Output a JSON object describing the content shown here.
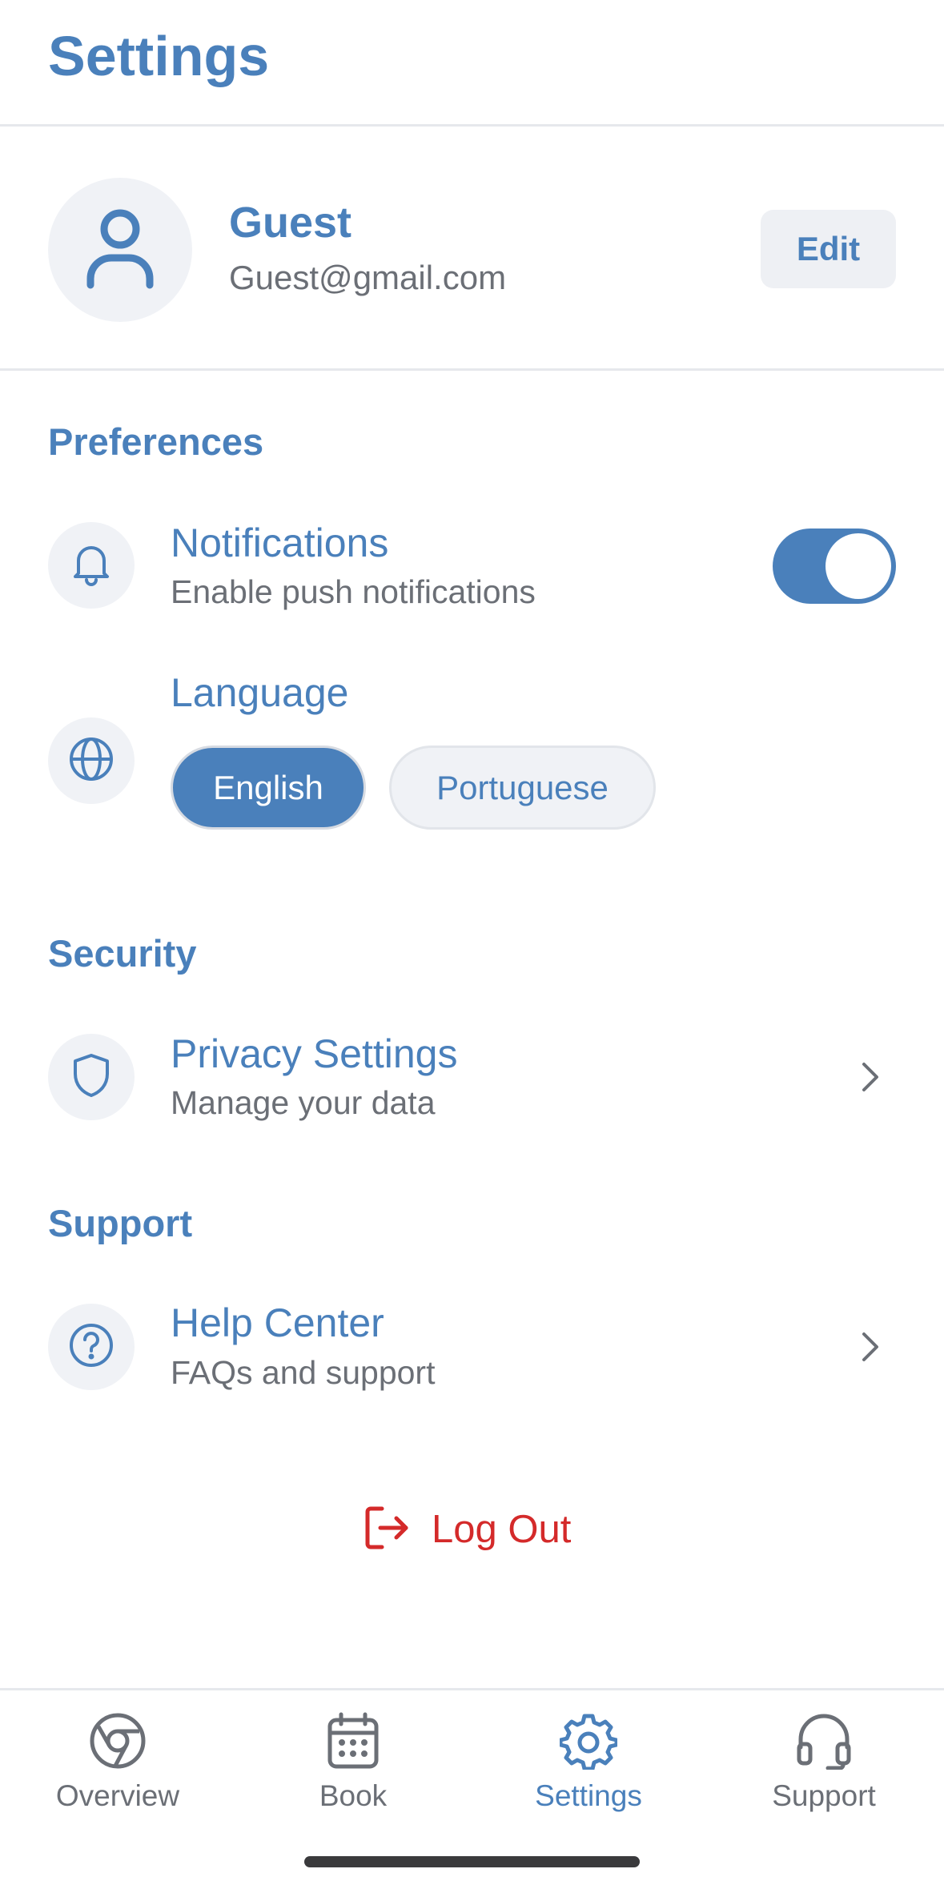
{
  "header": {
    "title": "Settings"
  },
  "profile": {
    "name": "Guest",
    "email": "Guest@gmail.com",
    "edit_label": "Edit",
    "avatar_icon": "user-icon"
  },
  "preferences": {
    "section_title": "Preferences",
    "notifications": {
      "title": "Notifications",
      "subtitle": "Enable push notifications",
      "icon": "bell-icon",
      "enabled": true
    },
    "language": {
      "title": "Language",
      "icon": "globe-icon",
      "options": [
        "English",
        "Portuguese"
      ],
      "selected": "English"
    }
  },
  "security": {
    "section_title": "Security",
    "privacy": {
      "title": "Privacy Settings",
      "subtitle": "Manage your data",
      "icon": "shield-icon"
    }
  },
  "support": {
    "section_title": "Support",
    "help": {
      "title": "Help Center",
      "subtitle": "FAQs and support",
      "icon": "help-circle-icon"
    }
  },
  "logout": {
    "label": "Log Out",
    "icon": "logout-icon"
  },
  "tabbar": {
    "tabs": [
      {
        "label": "Overview",
        "icon": "chrome-icon"
      },
      {
        "label": "Book",
        "icon": "calendar-icon"
      },
      {
        "label": "Settings",
        "icon": "gear-icon"
      },
      {
        "label": "Support",
        "icon": "headset-icon"
      }
    ],
    "active": "Settings"
  },
  "colors": {
    "accent": "#4a80bb",
    "danger": "#d42a2a",
    "muted_text": "#6b6f76",
    "chip_bg": "#f0f2f6",
    "divider": "#e6e8ec"
  }
}
